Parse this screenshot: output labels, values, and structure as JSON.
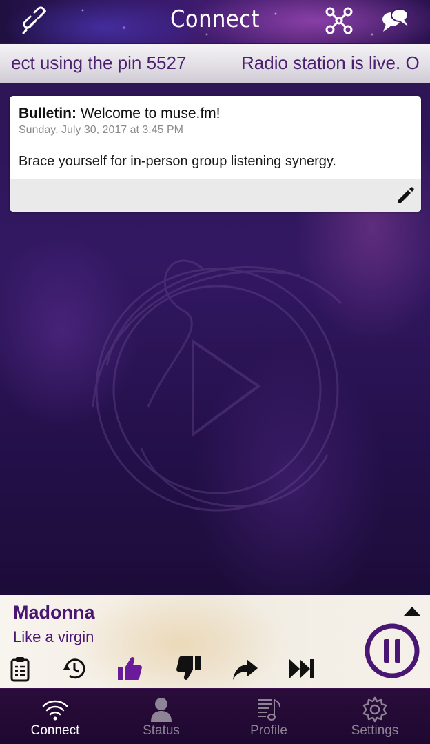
{
  "header": {
    "title": "Connect"
  },
  "ticker": {
    "message_left": "ect using the pin 5527",
    "message_right": "Radio station is live. O"
  },
  "bulletin": {
    "label": "Bulletin:",
    "title": "Welcome to muse.fm!",
    "date": "Sunday, July 30, 2017 at 3:45 PM",
    "body": "Brace yourself for in-person group listening synergy."
  },
  "player": {
    "artist": "Madonna",
    "song": "Like a virgin"
  },
  "tabs": [
    {
      "label": "Connect",
      "active": true
    },
    {
      "label": "Status",
      "active": false
    },
    {
      "label": "Profile",
      "active": false
    },
    {
      "label": "Settings",
      "active": false
    }
  ],
  "colors": {
    "accent": "#4a1673",
    "like_active": "#6a1b9a",
    "tab_active": "#ffffff",
    "tab_inactive": "#8d8496"
  }
}
